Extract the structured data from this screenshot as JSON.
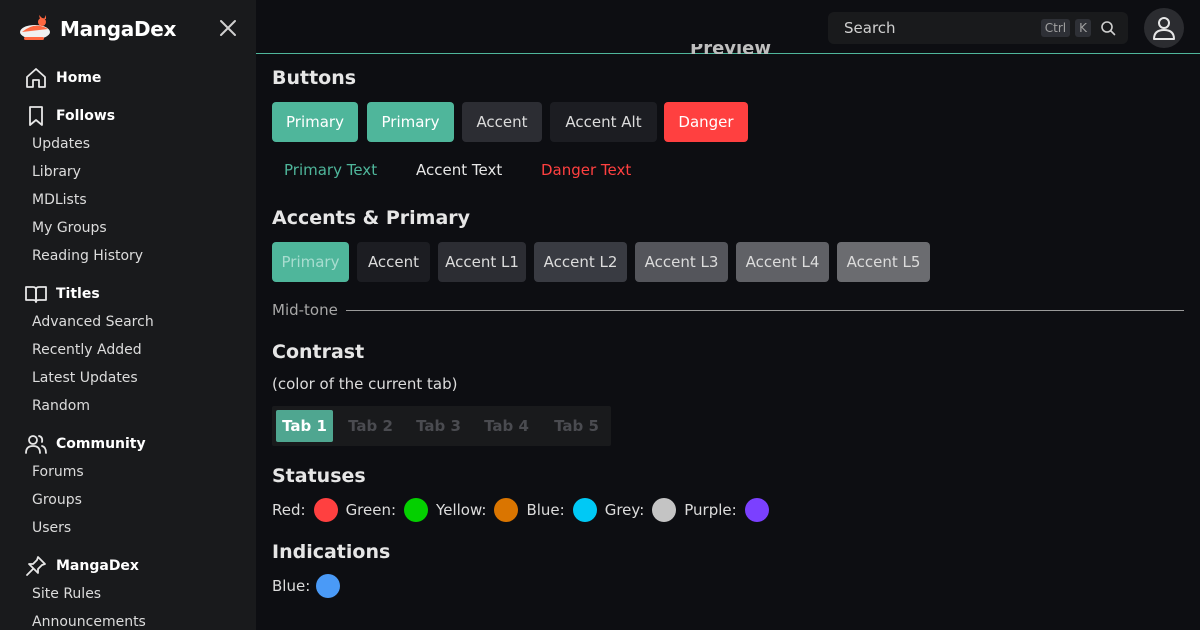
{
  "brand": {
    "name": "MangaDex"
  },
  "sidebar": {
    "sections": [
      {
        "label": "Home",
        "icon": "home-icon",
        "items": []
      },
      {
        "label": "Follows",
        "icon": "bookmark-icon",
        "items": [
          "Updates",
          "Library",
          "MDLists",
          "My Groups",
          "Reading History"
        ]
      },
      {
        "label": "Titles",
        "icon": "book-icon",
        "items": [
          "Advanced Search",
          "Recently Added",
          "Latest Updates",
          "Random"
        ]
      },
      {
        "label": "Community",
        "icon": "users-icon",
        "items": [
          "Forums",
          "Groups",
          "Users"
        ]
      },
      {
        "label": "MangaDex",
        "icon": "pin-icon",
        "items": [
          "Site Rules",
          "Announcements"
        ]
      }
    ]
  },
  "header": {
    "search_placeholder": "Search",
    "shortcut_ctrl": "Ctrl",
    "shortcut_key": "K",
    "preview_title": "Preview"
  },
  "buttons": {
    "heading": "Buttons",
    "solid": [
      "Primary",
      "Primary",
      "Accent",
      "Accent Alt",
      "Danger"
    ],
    "text": [
      "Primary Text",
      "Accent Text",
      "Danger Text"
    ]
  },
  "accents": {
    "heading": "Accents & Primary",
    "items": [
      "Primary",
      "Accent",
      "Accent L1",
      "Accent L2",
      "Accent L3",
      "Accent L4",
      "Accent L5"
    ],
    "midtone_label": "Mid-tone"
  },
  "contrast": {
    "heading": "Contrast",
    "subtext": "(color of the current tab)",
    "tabs": [
      "Tab 1",
      "Tab 2",
      "Tab 3",
      "Tab 4",
      "Tab 5"
    ]
  },
  "statuses": {
    "heading": "Statuses",
    "items": [
      {
        "label": "Red:",
        "color": "#ff4040"
      },
      {
        "label": "Green:",
        "color": "#04d000"
      },
      {
        "label": "Yellow:",
        "color": "#da7500"
      },
      {
        "label": "Blue:",
        "color": "#00c9f5"
      },
      {
        "label": "Grey:",
        "color": "#c4c4c4"
      },
      {
        "label": "Purple:",
        "color": "#7b40ff"
      }
    ]
  },
  "indications": {
    "heading": "Indications",
    "items": [
      {
        "label": "Blue:",
        "color": "#4a9af7"
      }
    ]
  },
  "colors": {
    "primary": "#4fb69b",
    "accent": "#2c2d33",
    "danger": "#ff4040"
  }
}
